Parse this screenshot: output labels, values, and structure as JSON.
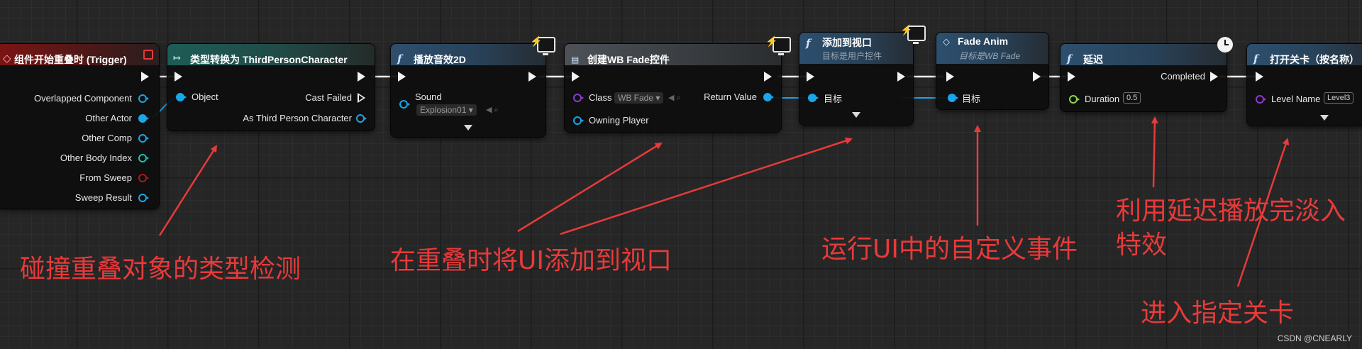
{
  "nodes": {
    "overlap_event": {
      "title": "组件开始重叠时 (Trigger)",
      "pins": [
        "Overlapped Component",
        "Other Actor",
        "Other Comp",
        "Other Body Index",
        "From Sweep",
        "Sweep Result"
      ]
    },
    "cast": {
      "title": "类型转换为 ThirdPersonCharacter",
      "object_label": "Object",
      "cast_failed_label": "Cast Failed",
      "as_label": "As Third Person Character"
    },
    "play_sound": {
      "title": "播放音效2D",
      "sound_label": "Sound",
      "sound_value": "Explosion01"
    },
    "create_widget": {
      "title": "创建WB Fade控件",
      "class_label": "Class",
      "class_value": "WB Fade",
      "return_label": "Return Value",
      "owner_label": "Owning Player"
    },
    "add_viewport": {
      "title": "添加到视口",
      "subtitle": "目标是用户控件",
      "target_label": "目标"
    },
    "fade_anim": {
      "title": "Fade Anim",
      "subtitle": "目标是WB Fade",
      "target_label": "目标"
    },
    "delay": {
      "title": "延迟",
      "completed_label": "Completed",
      "duration_label": "Duration",
      "duration_value": "0.5"
    },
    "open_level": {
      "title": "打开关卡（按名称）",
      "level_label": "Level Name",
      "level_value": "Level3"
    }
  },
  "annotations": {
    "type_check": "碰撞重叠对象的类型检测",
    "add_ui": "在重叠时将UI添加到视口",
    "custom_event": "运行UI中的自定义事件",
    "delay_fade_line1": "利用延迟播放完淡入",
    "delay_fade_line2": "特效",
    "enter_level": "进入指定关卡"
  },
  "watermark": "CSDN @CNEARLY",
  "colors": {
    "annotation": "#e83a3a",
    "exec_wire": "#f2f2f2",
    "object_wire": "#1aa6ea"
  }
}
